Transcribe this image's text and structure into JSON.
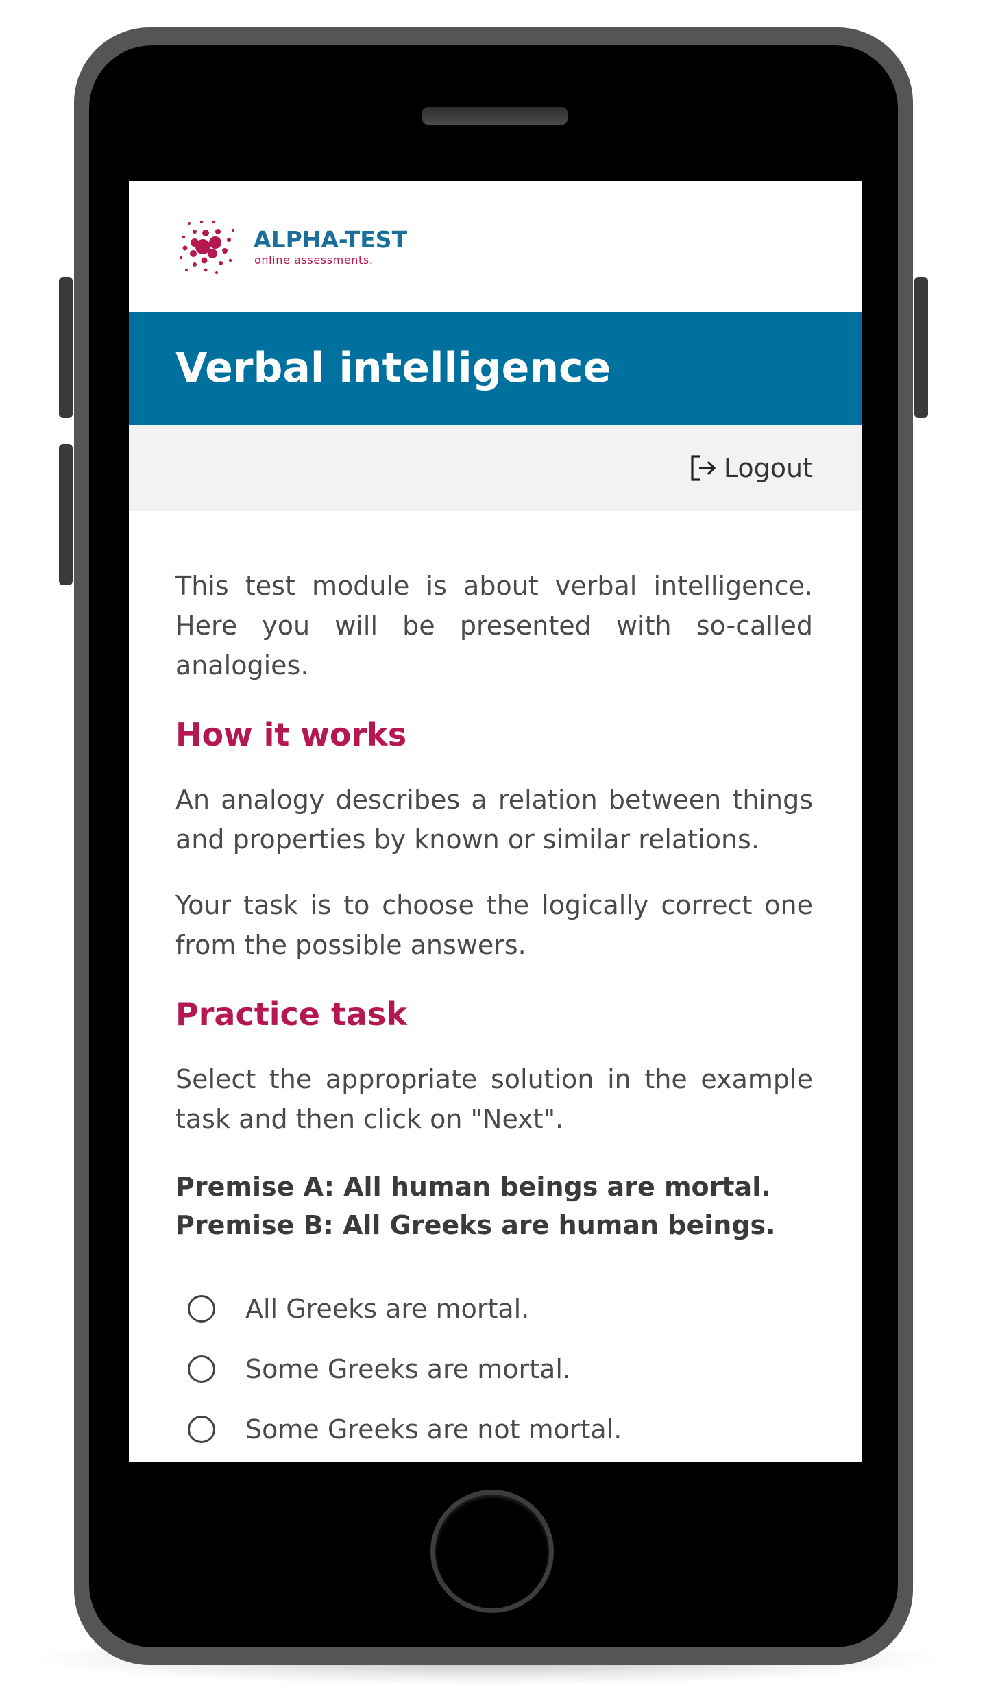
{
  "brand": {
    "name": "ALPHA-TEST",
    "tagline": "online assessments."
  },
  "header": {
    "title": "Verbal intelligence"
  },
  "toolbar": {
    "logout_label": "Logout"
  },
  "content": {
    "intro": "This test module is about verbal intelligence. Here you will be presented with so-called analogies.",
    "sections": [
      {
        "heading": "How it works",
        "paragraphs": [
          "An analogy describes a relation between things and properties by known or similar relations.",
          "Your task is to choose the logically correct one from the possible answers."
        ]
      },
      {
        "heading": "Practice task",
        "paragraphs": [
          "Select the appropriate solution in the example task and then click on \"Next\"."
        ]
      }
    ],
    "premises": [
      "Premise A: All human beings are mortal.",
      "Premise B: All Greeks are human beings."
    ],
    "options": [
      {
        "label": "All Greeks are mortal.",
        "selected": false
      },
      {
        "label": "Some Greeks are mortal.",
        "selected": false
      },
      {
        "label": "Some Greeks are not mortal.",
        "selected": false
      }
    ]
  },
  "colors": {
    "header_bg": "#00709e",
    "accent": "#b5174f",
    "logout_bar_bg": "#f2f2f2"
  }
}
